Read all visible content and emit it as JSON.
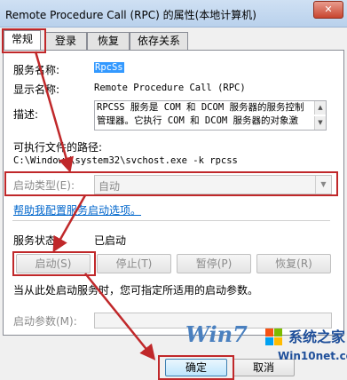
{
  "window": {
    "title": "Remote Procedure Call (RPC) 的属性(本地计算机)",
    "close_label": "✕"
  },
  "tabs": [
    {
      "label": "常规"
    },
    {
      "label": "登录"
    },
    {
      "label": "恢复"
    },
    {
      "label": "依存关系"
    }
  ],
  "general": {
    "service_name_label": "服务名称:",
    "service_name_value": "RpcSs",
    "display_name_label": "显示名称:",
    "display_name_value": "Remote Procedure Call (RPC)",
    "description_label": "描述:",
    "description_line1": "RPCSS 服务是 COM 和 DCOM 服务器的服务控制",
    "description_line2": "管理器。它执行 COM 和 DCOM 服务器的对象激",
    "exe_path_label": "可执行文件的路径:",
    "exe_path_value": "C:\\Windows\\system32\\svchost.exe -k rpcss",
    "startup_type_label": "启动类型(E):",
    "startup_type_value": "自动",
    "help_link": "帮助我配置服务启动选项。",
    "service_status_label": "服务状态:",
    "service_status_value": "已启动",
    "start_button": "启动(S)",
    "stop_button": "停止(T)",
    "pause_button": "暂停(P)",
    "resume_button": "恢复(R)",
    "hint_text": "当从此处启动服务时，您可指定所适用的启动参数。",
    "start_params_label": "启动参数(M):",
    "start_params_value": ""
  },
  "footer": {
    "ok_button": "确定",
    "cancel_button": "取消"
  },
  "watermark": {
    "logo_text": "Win7",
    "site_name": "系统之家",
    "site_url": "Win10net.com"
  },
  "colors": {
    "annotation_red": "#c0282a",
    "link_blue": "#0066cc",
    "selection_blue": "#3399ff"
  }
}
